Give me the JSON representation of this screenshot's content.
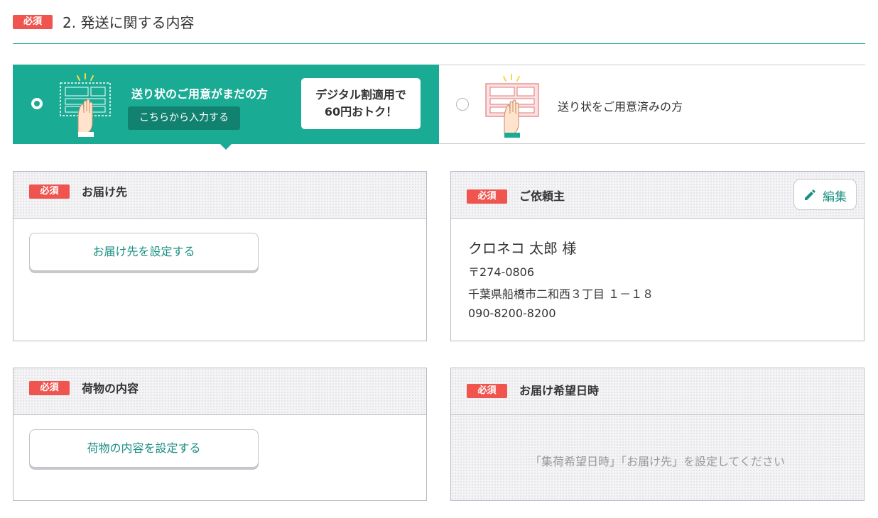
{
  "section": {
    "badge": "必須",
    "title": "2. 発送に関する内容"
  },
  "options": {
    "left": {
      "title": "送り状のご用意がまだの方",
      "input_button": "こちらから入力する",
      "promo_line1": "デジタル割適用で",
      "promo_line2": "60円おトク！",
      "selected": true,
      "icon": "hand-holding-label-icon"
    },
    "right": {
      "title": "送り状をご用意済みの方",
      "selected": false,
      "icon": "hand-holding-slip-icon"
    }
  },
  "panels": {
    "destination": {
      "badge": "必須",
      "title": "お届け先",
      "button": "お届け先を設定する"
    },
    "sender": {
      "badge": "必須",
      "title": "ご依頼主",
      "edit_label": "編集",
      "name": "クロネコ 太郎 様",
      "postal": "〒274-0806",
      "address": "千葉県船橋市二和西３丁目 １－１８",
      "phone": "090-8200-8200"
    },
    "contents": {
      "badge": "必須",
      "title": "荷物の内容",
      "button": "荷物の内容を設定する"
    },
    "delivery_time": {
      "badge": "必須",
      "title": "お届け希望日時",
      "hint": "「集荷希望日時」「お届け先」を設定してください"
    }
  },
  "colors": {
    "accent": "#1aab95",
    "required_badge": "#f0544f",
    "button_text": "#1a8f82"
  }
}
